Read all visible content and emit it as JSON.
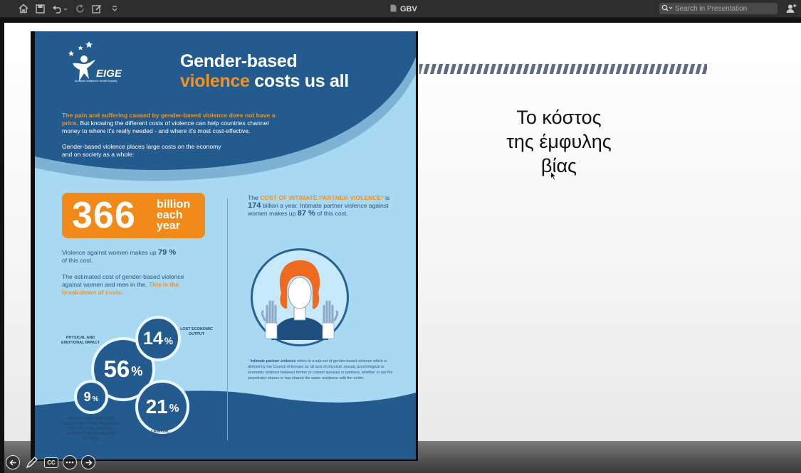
{
  "toolbar": {
    "title": "GBV",
    "search_placeholder": "Search in Presentation",
    "icons": [
      "home-icon",
      "save-icon",
      "undo-icon",
      "redo-icon",
      "markup-icon",
      "overflow-icon",
      "document-icon",
      "search-icon",
      "share-icon"
    ]
  },
  "slide": {
    "title": "Το κόστος\nτης έμφυλης\nβίας",
    "accent_color": "#5e6c86"
  },
  "poster": {
    "logo_text": "EIGE",
    "logo_subtext": "European Institute for Gender Equality",
    "title_line1": "Gender-based",
    "title_line2_orange": "violence",
    "title_line2_rest": " costs us all",
    "intro_orange": "The pain and suffering caused by gender-based violence does not have a price.",
    "intro_rest": " But knowing the different costs of violence can help countries channel money to where it's really needed - and where it's most cost-effective.",
    "intro2": "Gender-based violence places large costs on the economy and on society as a whole:",
    "big_number": "366",
    "big_unit_1": "billion",
    "big_unit_2": "each",
    "big_unit_3": "year",
    "women_share_prefix": "Violence against women makes up ",
    "women_share_value": "79 %",
    "women_share_suffix": "of this cost.",
    "breakdown_intro": "The estimated cost of gender-based violence  against women and men in the. ",
    "breakdown_orange": "This is the break-down of costs:",
    "ipv_prefix": "The ",
    "ipv_orange": "COST OF INTIMATE PARTNER VIOLENCE*",
    "ipv_mid1": " is ",
    "ipv_value1": "174",
    "ipv_mid2": " billion a year. Intimate partner violence against women makes up ",
    "ipv_value2": "87 %",
    "ipv_suffix": " of this cost.",
    "note_star": "* ",
    "note_bold": "Intimate partner violence",
    "note_rest": " refers to a sub-set of gender-based violence which is defined by the Council of Europe as 'all acts of physical, sexual, psychological or economic violence between former or current spouses or partners, whether or not the perpetrator shares or has shared the same residence with the victim.",
    "breakdown": [
      {
        "value": "56",
        "unit": "%",
        "label": "PHYSICAL AND EMOTIONAL IMPACT"
      },
      {
        "value": "14",
        "unit": "%",
        "label": "LOST ECONOMIC OUTPUT"
      },
      {
        "value": "9",
        "unit": "%",
        "label": "HEALTH CARE SERVICES, SOCIAL WELFARE, PERSONAL COSTS, CIVIL JUSTICE, SUPPORT SERVICES FOR VICTIMS."
      },
      {
        "value": "21",
        "unit": "%",
        "label": "CRIMINAL JUSTICE"
      }
    ],
    "colors": {
      "navy": "#245b8e",
      "light_blue": "#a8d9f2",
      "orange": "#f28a1a"
    }
  },
  "controls": {
    "icons": [
      "previous-slide-icon",
      "pen-tool-icon",
      "captions-icon",
      "more-icon",
      "next-slide-icon"
    ],
    "captions_label": "CC"
  }
}
